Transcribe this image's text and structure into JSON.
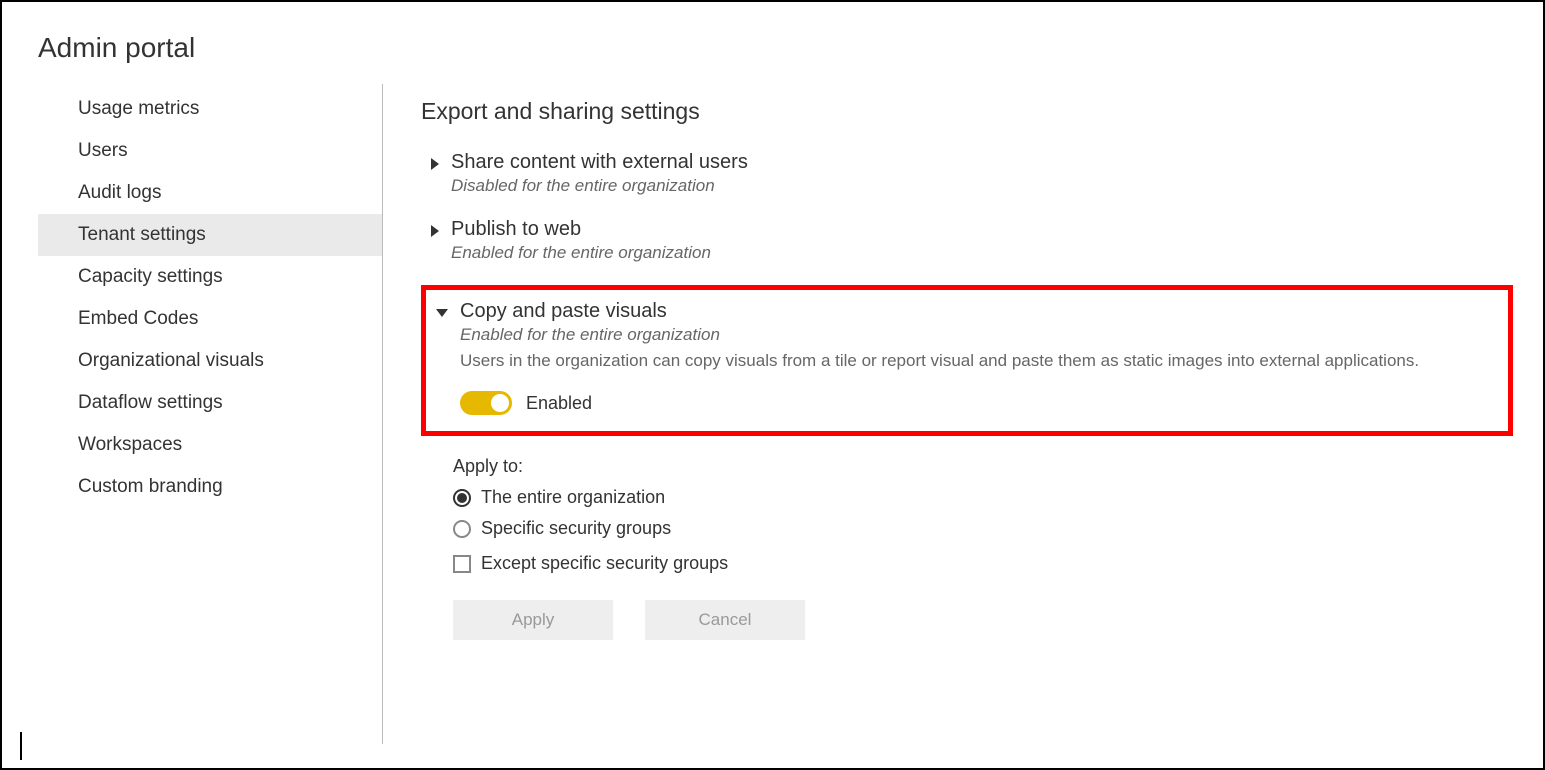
{
  "page_title": "Admin portal",
  "sidebar": {
    "items": [
      {
        "label": "Usage metrics"
      },
      {
        "label": "Users"
      },
      {
        "label": "Audit logs"
      },
      {
        "label": "Tenant settings"
      },
      {
        "label": "Capacity settings"
      },
      {
        "label": "Embed Codes"
      },
      {
        "label": "Organizational visuals"
      },
      {
        "label": "Dataflow settings"
      },
      {
        "label": "Workspaces"
      },
      {
        "label": "Custom branding"
      }
    ],
    "selected_index": 3
  },
  "main": {
    "section_title": "Export and sharing settings",
    "settings": [
      {
        "title": "Share content with external users",
        "status": "Disabled for the entire organization"
      },
      {
        "title": "Publish to web",
        "status": "Enabled for the entire organization"
      },
      {
        "title": "Copy and paste visuals",
        "status": "Enabled for the entire organization",
        "description": "Users in the organization can copy visuals from a tile or report visual and paste them as static images into external applications.",
        "toggle_label": "Enabled"
      }
    ],
    "apply_to": {
      "label": "Apply to:",
      "options": [
        "The entire organization",
        "Specific security groups"
      ],
      "selected": 0,
      "except_label": "Except specific security groups"
    },
    "buttons": {
      "apply": "Apply",
      "cancel": "Cancel"
    }
  }
}
